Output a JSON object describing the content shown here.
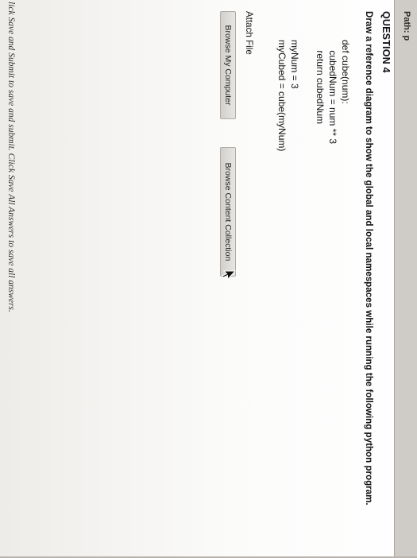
{
  "path_bar": {
    "label": "Path: p"
  },
  "question": {
    "title": "QUESTION 4",
    "prompt": "Draw a reference diagram to show the global and local namespaces while running the following python program."
  },
  "code_lines": [
    "def cube(num):",
    "    cubedNum = num ** 3",
    "    return cubedNum",
    "",
    "myNum = 3",
    "myCubed = cube(myNum)"
  ],
  "attach": {
    "label": "Attach File",
    "browse_computer": "Browse My Computer",
    "browse_content": "Browse Content Collection"
  },
  "footer": {
    "prefix": "lick Save and Submit to save and submit. Click Save All Answers to save all answers."
  }
}
